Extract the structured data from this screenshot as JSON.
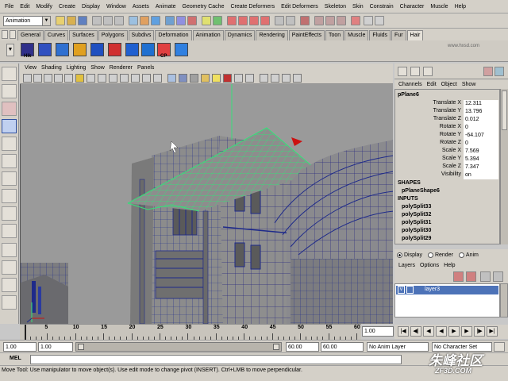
{
  "menubar": {
    "items": [
      "File",
      "Edit",
      "Modify",
      "Create",
      "Display",
      "Window",
      "Assets",
      "Animate",
      "Geometry Cache",
      "Create Deformers",
      "Edit Deformers",
      "Skeleton",
      "Skin",
      "Constrain",
      "Character",
      "Muscle",
      "Help"
    ]
  },
  "statusline": {
    "mode": "Animation"
  },
  "shelf": {
    "tabs": [
      "General",
      "Curves",
      "Surfaces",
      "Polygons",
      "Subdivs",
      "Deformation",
      "Animation",
      "Dynamics",
      "Rendering",
      "PaintEffects",
      "Toon",
      "Muscle",
      "Fluids",
      "Fur",
      "Hair"
    ],
    "active_tab": "Hair",
    "hik_label": "Hik",
    "cp_label": "CP"
  },
  "viewport": {
    "menu": [
      "View",
      "Shading",
      "Lighting",
      "Show",
      "Renderer",
      "Panels"
    ]
  },
  "channelbox": {
    "menu": [
      "Channels",
      "Edit",
      "Object",
      "Show"
    ],
    "node": "pPlane6",
    "attributes": [
      {
        "name": "Translate X",
        "value": "12.311"
      },
      {
        "name": "Translate Y",
        "value": "13.796"
      },
      {
        "name": "Translate Z",
        "value": "0.012"
      },
      {
        "name": "Rotate X",
        "value": "0"
      },
      {
        "name": "Rotate Y",
        "value": "-64.107"
      },
      {
        "name": "Rotate Z",
        "value": "0"
      },
      {
        "name": "Scale X",
        "value": "7.569"
      },
      {
        "name": "Scale Y",
        "value": "5.394"
      },
      {
        "name": "Scale Z",
        "value": "7.347"
      },
      {
        "name": "Visibility",
        "value": "on"
      }
    ],
    "shapes_label": "SHAPES",
    "shape_node": "pPlaneShape6",
    "inputs_label": "INPUTS",
    "inputs": [
      "polySplit33",
      "polySplit32",
      "polySplit31",
      "polySplit30",
      "polySplit29"
    ]
  },
  "layers": {
    "modes": [
      "Display",
      "Render",
      "Anim"
    ],
    "menu": [
      "Layers",
      "Options",
      "Help"
    ],
    "layer_name": "layer3",
    "visible_flag": "V"
  },
  "timeslider": {
    "ticks": [
      "5",
      "10",
      "15",
      "20",
      "25",
      "30",
      "35",
      "40",
      "45",
      "50",
      "55",
      "60"
    ],
    "current_frame": "1.00"
  },
  "rangeslider": {
    "start_time": "1.00",
    "range_start": "1.00",
    "range_end": "60.00",
    "end_time": "60.00",
    "anim_layer": "No Anim Layer",
    "character_set": "No Character Set"
  },
  "cmdline": {
    "label": "MEL"
  },
  "helpline": {
    "text": "Move Tool: Use manipulator to move object(s). Use edit mode to change pivot (INSERT).  Ctrl+LMB to move perpendicular."
  },
  "watermarks": {
    "top_right_site": "www.hxsd.com",
    "bottom_right_site": "ZF3D.COM",
    "bottom_right_brand": "朱峰社区"
  },
  "colors": {
    "ui_gray": "#d4d0c8",
    "viewport_bg": "#9a9a9a",
    "wire_blue": "#1e2a8a",
    "selection_green": "#36e07a",
    "layer_highlight": "#4d73b8"
  }
}
